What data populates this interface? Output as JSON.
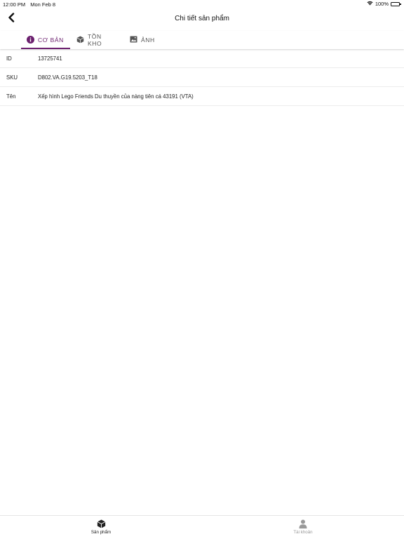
{
  "status_bar": {
    "time": "12:00 PM",
    "date": "Mon Feb 8",
    "battery": "100%"
  },
  "nav": {
    "title": "Chi tiết sản phẩm"
  },
  "tabs": [
    {
      "label": "CƠ BẢN",
      "icon": "info-circle-icon",
      "active": true
    },
    {
      "label": "TỒN KHO",
      "icon": "box-icon",
      "active": false
    },
    {
      "label": "ẢNH",
      "icon": "image-icon",
      "active": false
    }
  ],
  "details": [
    {
      "label": "ID",
      "value": "13725741"
    },
    {
      "label": "SKU",
      "value": "D802.VA.G19.5203_T18"
    },
    {
      "label": "Tên",
      "value": "Xếp hình Lego Friends Du thuyền của nàng tiên cá 43191 (VTA)"
    }
  ],
  "bottom_tabs": [
    {
      "label": "Sản phẩm",
      "icon": "cube-icon",
      "active": true
    },
    {
      "label": "Tài khoản",
      "icon": "person-icon",
      "active": false
    }
  ],
  "colors": {
    "accent": "#6b1f6e",
    "inactive": "#999999"
  }
}
